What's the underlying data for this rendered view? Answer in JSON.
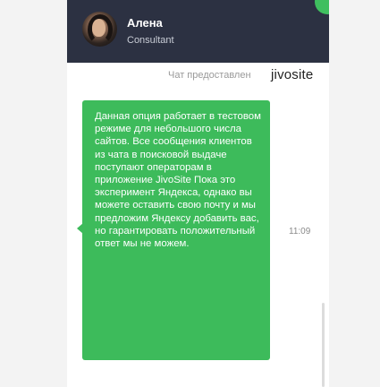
{
  "header": {
    "agent_name": "Алена",
    "agent_role": "Consultant"
  },
  "powered_by": {
    "text": "Чат предоставлен",
    "brand": "jivosite"
  },
  "message": {
    "text": "Данная опция работает в тестовом режиме для небольшого числа сайтов. Все сообщения клиентов из чата в поисковой выдаче поступают операторам в приложение JivoSite Пока это эксперимент Яндекса, однако вы можете оставить свою почту и мы предложим Яндексу добавить вас, но гарантировать положительный ответ мы не можем.",
    "time": "11:09"
  },
  "colors": {
    "header_bg": "#2c3142",
    "bubble_bg": "#3dbb5b",
    "accent": "#3fbf5f"
  },
  "icons": {
    "avatar": "agent-photo",
    "corner": "green-status-dot"
  }
}
